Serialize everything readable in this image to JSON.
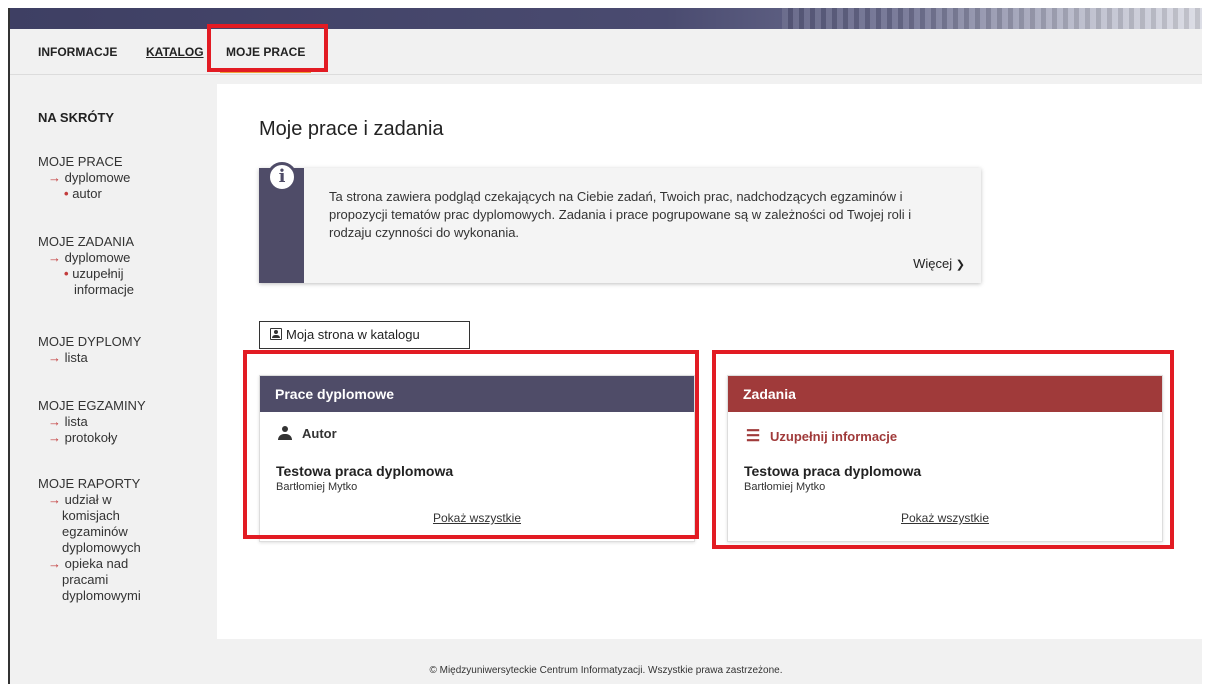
{
  "nav": {
    "tabs": [
      {
        "label": "INFORMACJE"
      },
      {
        "label": "KATALOG"
      },
      {
        "label": "MOJE PRACE"
      }
    ]
  },
  "sidebar": {
    "title": "NA SKRÓTY",
    "groups": [
      {
        "head": "MOJE PRACE",
        "link": "dyplomowe",
        "sub": "autor"
      },
      {
        "head": "MOJE ZADANIA",
        "link": "dyplomowe",
        "sub_lines": [
          "uzupełnij",
          "informacje"
        ]
      },
      {
        "head": "MOJE DYPLOMY",
        "link": "lista"
      },
      {
        "head": "MOJE EGZAMINY",
        "links": [
          "lista",
          "protokoły"
        ]
      },
      {
        "head": "MOJE RAPORTY",
        "link1_lines": [
          "udział w",
          "komisjach",
          "egzaminów",
          "dyplomowych"
        ],
        "link2_lines": [
          "opieka nad",
          "pracami",
          "dyplomowymi"
        ]
      }
    ]
  },
  "main": {
    "title": "Moje prace i zadania",
    "info": {
      "text": "Ta strona zawiera podgląd czekających na Ciebie zadań, Twoich prac, nadchodzących egzaminów i propozycji tematów prac dyplomowych. Zadania i prace pogrupowane są w zależności od Twojej roli i rodzaju czynności do wykonania.",
      "more": "Więcej"
    },
    "catalog_button": "Moja strona w katalogu",
    "cards": [
      {
        "header": "Prace dyplomowe",
        "role": "Autor",
        "item_title": "Testowa praca dyplomowa",
        "item_author": "Bartłomiej Mytko",
        "link": "Pokaż wszystkie"
      },
      {
        "header": "Zadania",
        "role": "Uzupełnij informacje",
        "item_title": "Testowa praca dyplomowa",
        "item_author": "Bartłomiej Mytko",
        "link": "Pokaż wszystkie"
      }
    ]
  },
  "footer": {
    "text": "© Międzyuniwersyteckie Centrum Informatyzacji. Wszystkie prawa zastrzeżone."
  },
  "colors": {
    "primary": "#4f4c68",
    "tasks": "#a03a3a",
    "tab_underline": "#f0a33a",
    "highlight": "#e21b23"
  }
}
